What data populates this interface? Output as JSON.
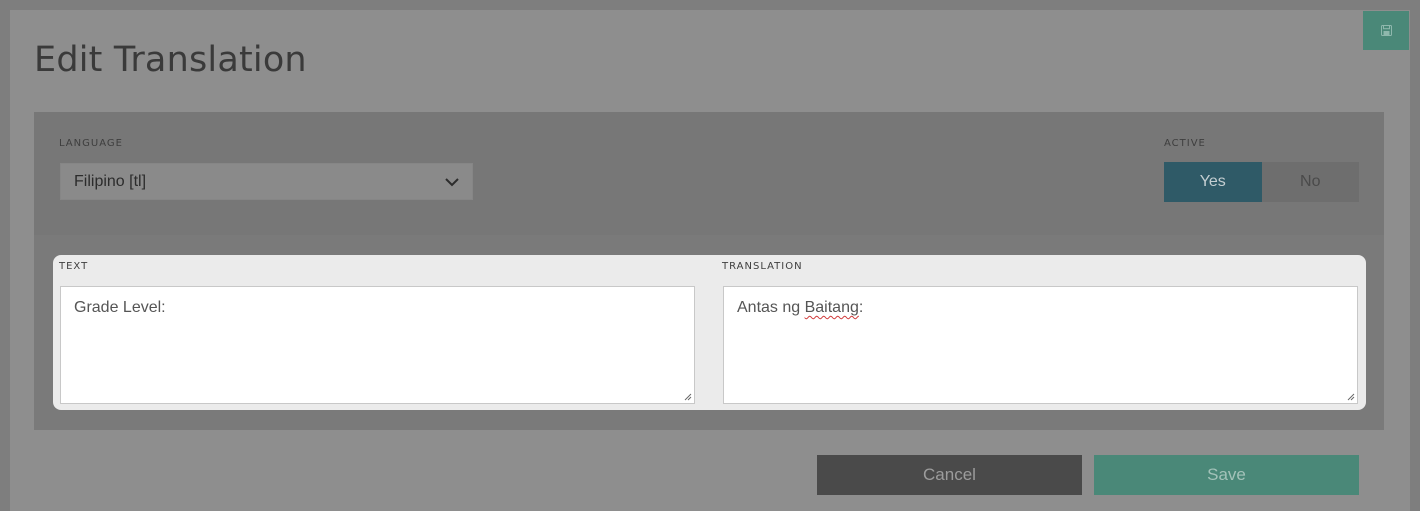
{
  "header": {
    "title": "Edit Translation",
    "save_icon": "floppy-disk-icon"
  },
  "settings": {
    "language_label": "LANGUAGE",
    "language_value": "Filipino [tl]",
    "active_label": "ACTIVE",
    "active_yes": "Yes",
    "active_no": "No",
    "active_selected": "Yes"
  },
  "editor": {
    "text_label": "TEXT",
    "text_value": "Grade Level:",
    "translation_label": "TRANSLATION",
    "translation_prefix": "Antas ng ",
    "translation_misspelled": "Baitang",
    "translation_suffix": ":"
  },
  "actions": {
    "cancel_label": "Cancel",
    "save_label": "Save"
  },
  "colors": {
    "accent_teal": "#4a8878",
    "active_toggle": "#2f5a67",
    "cancel_button": "#4a4a4a"
  }
}
